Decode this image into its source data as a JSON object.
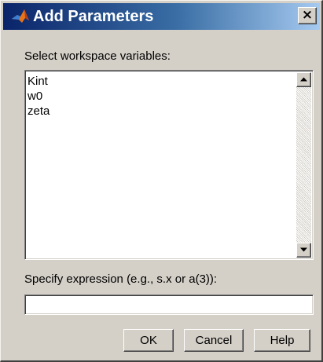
{
  "window": {
    "title": "Add Parameters",
    "close_glyph": "×",
    "icon": "matlab-logo-icon"
  },
  "variables": {
    "label": "Select workspace variables:",
    "items": [
      "Kint",
      "w0",
      "zeta"
    ]
  },
  "expression": {
    "label": "Specify expression (e.g., s.x or a(3)):",
    "value": ""
  },
  "buttons": {
    "ok": "OK",
    "cancel": "Cancel",
    "help": "Help"
  },
  "colors": {
    "title_bar_start": "#0a246a",
    "title_bar_end": "#a6caf0",
    "face": "#d4d0c8"
  }
}
